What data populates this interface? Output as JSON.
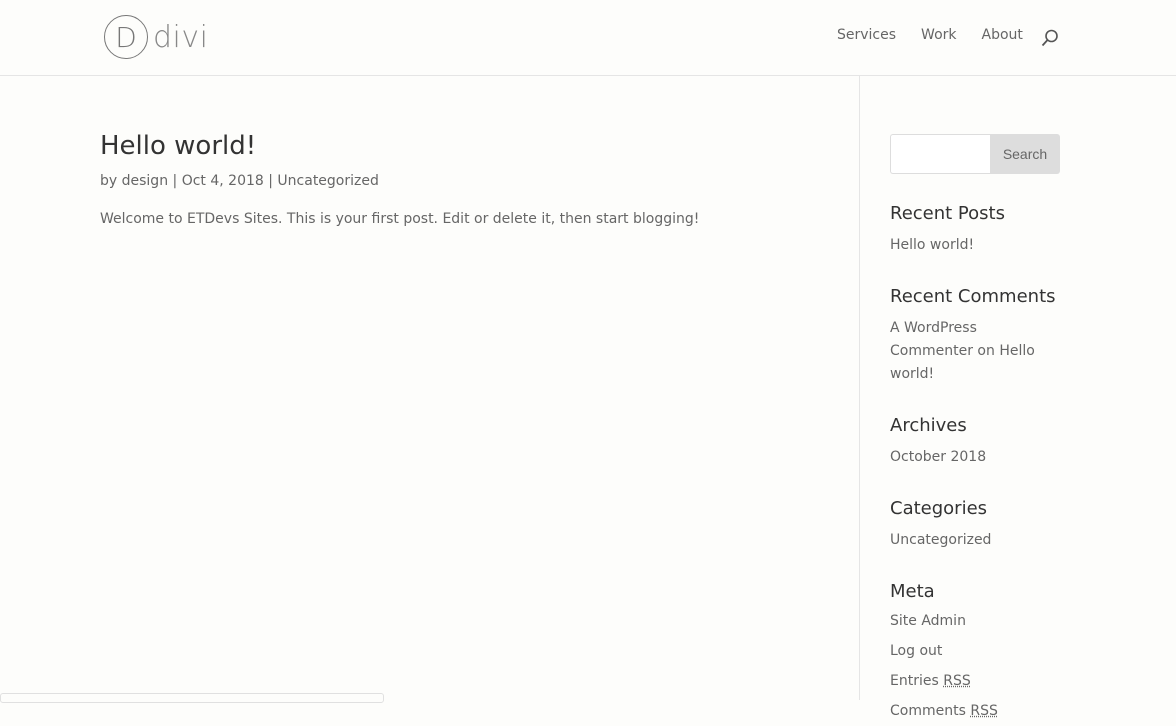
{
  "header": {
    "logo_letter": "D",
    "logo_text": "divi",
    "nav": [
      "Services",
      "Work",
      "About"
    ]
  },
  "post": {
    "title": "Hello world!",
    "by": "by",
    "author": "design",
    "sep": "|",
    "date": "Oct 4, 2018",
    "category": "Uncategorized",
    "excerpt": "Welcome to ETDevs Sites. This is your first post. Edit or delete it, then start blogging!"
  },
  "sidebar": {
    "search_button": "Search",
    "recent_posts": {
      "title": "Recent Posts",
      "items": [
        "Hello world!"
      ]
    },
    "recent_comments": {
      "title": "Recent Comments",
      "author": "A WordPress Commenter",
      "on": "on",
      "post": "Hello world!"
    },
    "archives": {
      "title": "Archives",
      "items": [
        "October 2018"
      ]
    },
    "categories": {
      "title": "Categories",
      "items": [
        "Uncategorized"
      ]
    },
    "meta": {
      "title": "Meta",
      "site_admin": "Site Admin",
      "log_out": "Log out",
      "entries": "Entries",
      "comments": "Comments",
      "rss": "RSS"
    }
  }
}
